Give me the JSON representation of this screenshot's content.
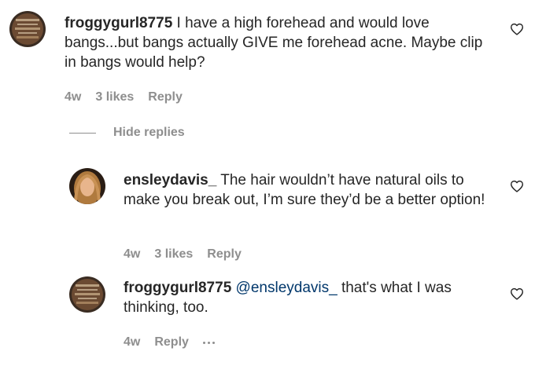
{
  "comments": [
    {
      "username": "froggygurl8775",
      "text": " I have a high forehead and would love bangs...but bangs actually GIVE me forehead acne. Maybe clip in bangs would help?",
      "time": "4w",
      "likes": "3 likes",
      "reply_label": "Reply"
    }
  ],
  "hide_replies_label": "Hide replies",
  "replies": [
    {
      "username": "ensleydavis_",
      "text": " The hair wouldn’t have natural oils to make you break out, I’m sure they’d be a better option!",
      "time": "4w",
      "likes": "3 likes",
      "reply_label": "Reply"
    },
    {
      "username": "froggygurl8775",
      "mention": "@ensleydavis_",
      "text": " that's what I was thinking, too.",
      "time": "4w",
      "reply_label": "Reply"
    }
  ],
  "colors": {
    "text": "#262626",
    "secondary": "#8e8e8e",
    "mention": "#00376b"
  },
  "icons": {
    "like": "heart-outline-icon",
    "more": "more-options-icon"
  }
}
